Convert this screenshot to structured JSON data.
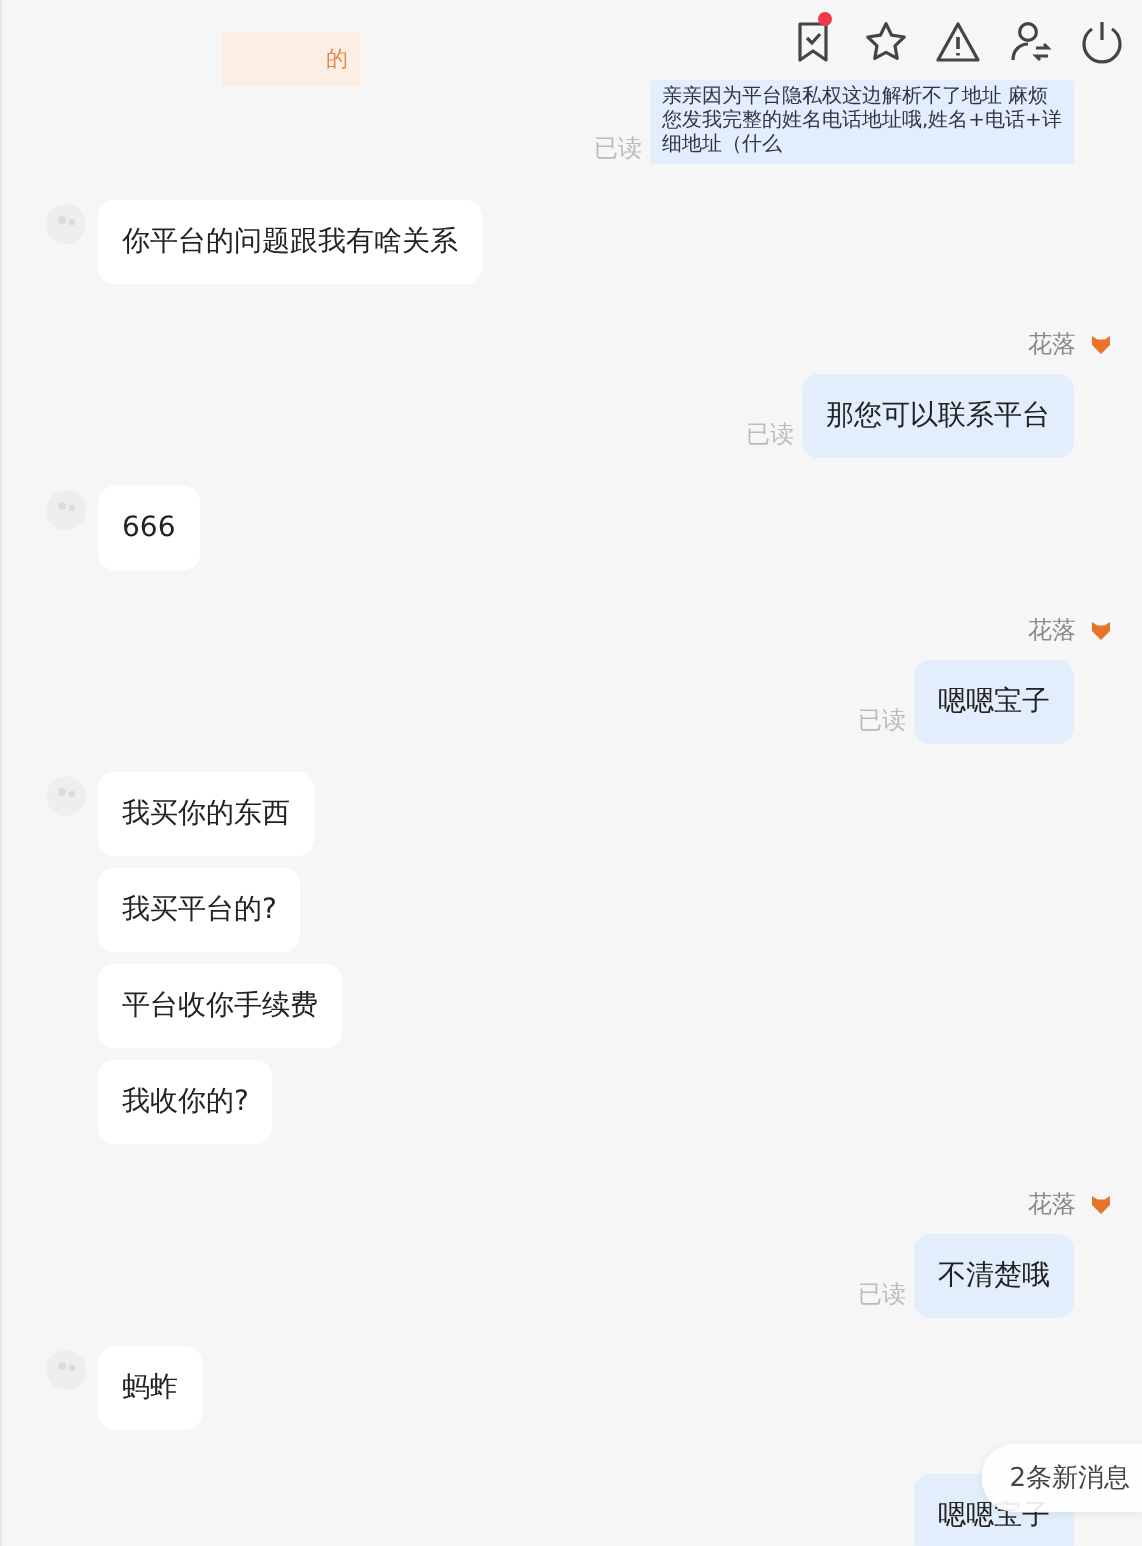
{
  "header": {
    "tag": "的",
    "review_dot": true
  },
  "messages": [
    {
      "kind": "outgoing",
      "compact": true,
      "text": "亲亲因为平台隐私权这边解析不了地址 麻烦您发我完整的姓名电话地址哦,姓名+电话+详细地址（什么",
      "read": "已读"
    },
    {
      "kind": "incoming",
      "texts": [
        "你平台的问题跟我有啥关系"
      ]
    },
    {
      "kind": "outgoing",
      "compact": false,
      "sender": "花落",
      "text": "那您可以联系平台",
      "read": "已读"
    },
    {
      "kind": "incoming",
      "texts": [
        "666"
      ]
    },
    {
      "kind": "outgoing",
      "compact": false,
      "sender": "花落",
      "text": "嗯嗯宝子",
      "read": "已读"
    },
    {
      "kind": "incoming",
      "texts": [
        "我买你的东西",
        "我买平台的?",
        "平台收你手续费",
        "我收你的?"
      ]
    },
    {
      "kind": "outgoing",
      "compact": false,
      "sender": "花落",
      "text": "不清楚哦",
      "read": "已读"
    },
    {
      "kind": "incoming",
      "texts": [
        "蚂蚱"
      ]
    },
    {
      "kind": "outgoing",
      "compact": false,
      "text": "嗯嗯宝子"
    }
  ],
  "new_messages": {
    "label": "2条新消息"
  }
}
